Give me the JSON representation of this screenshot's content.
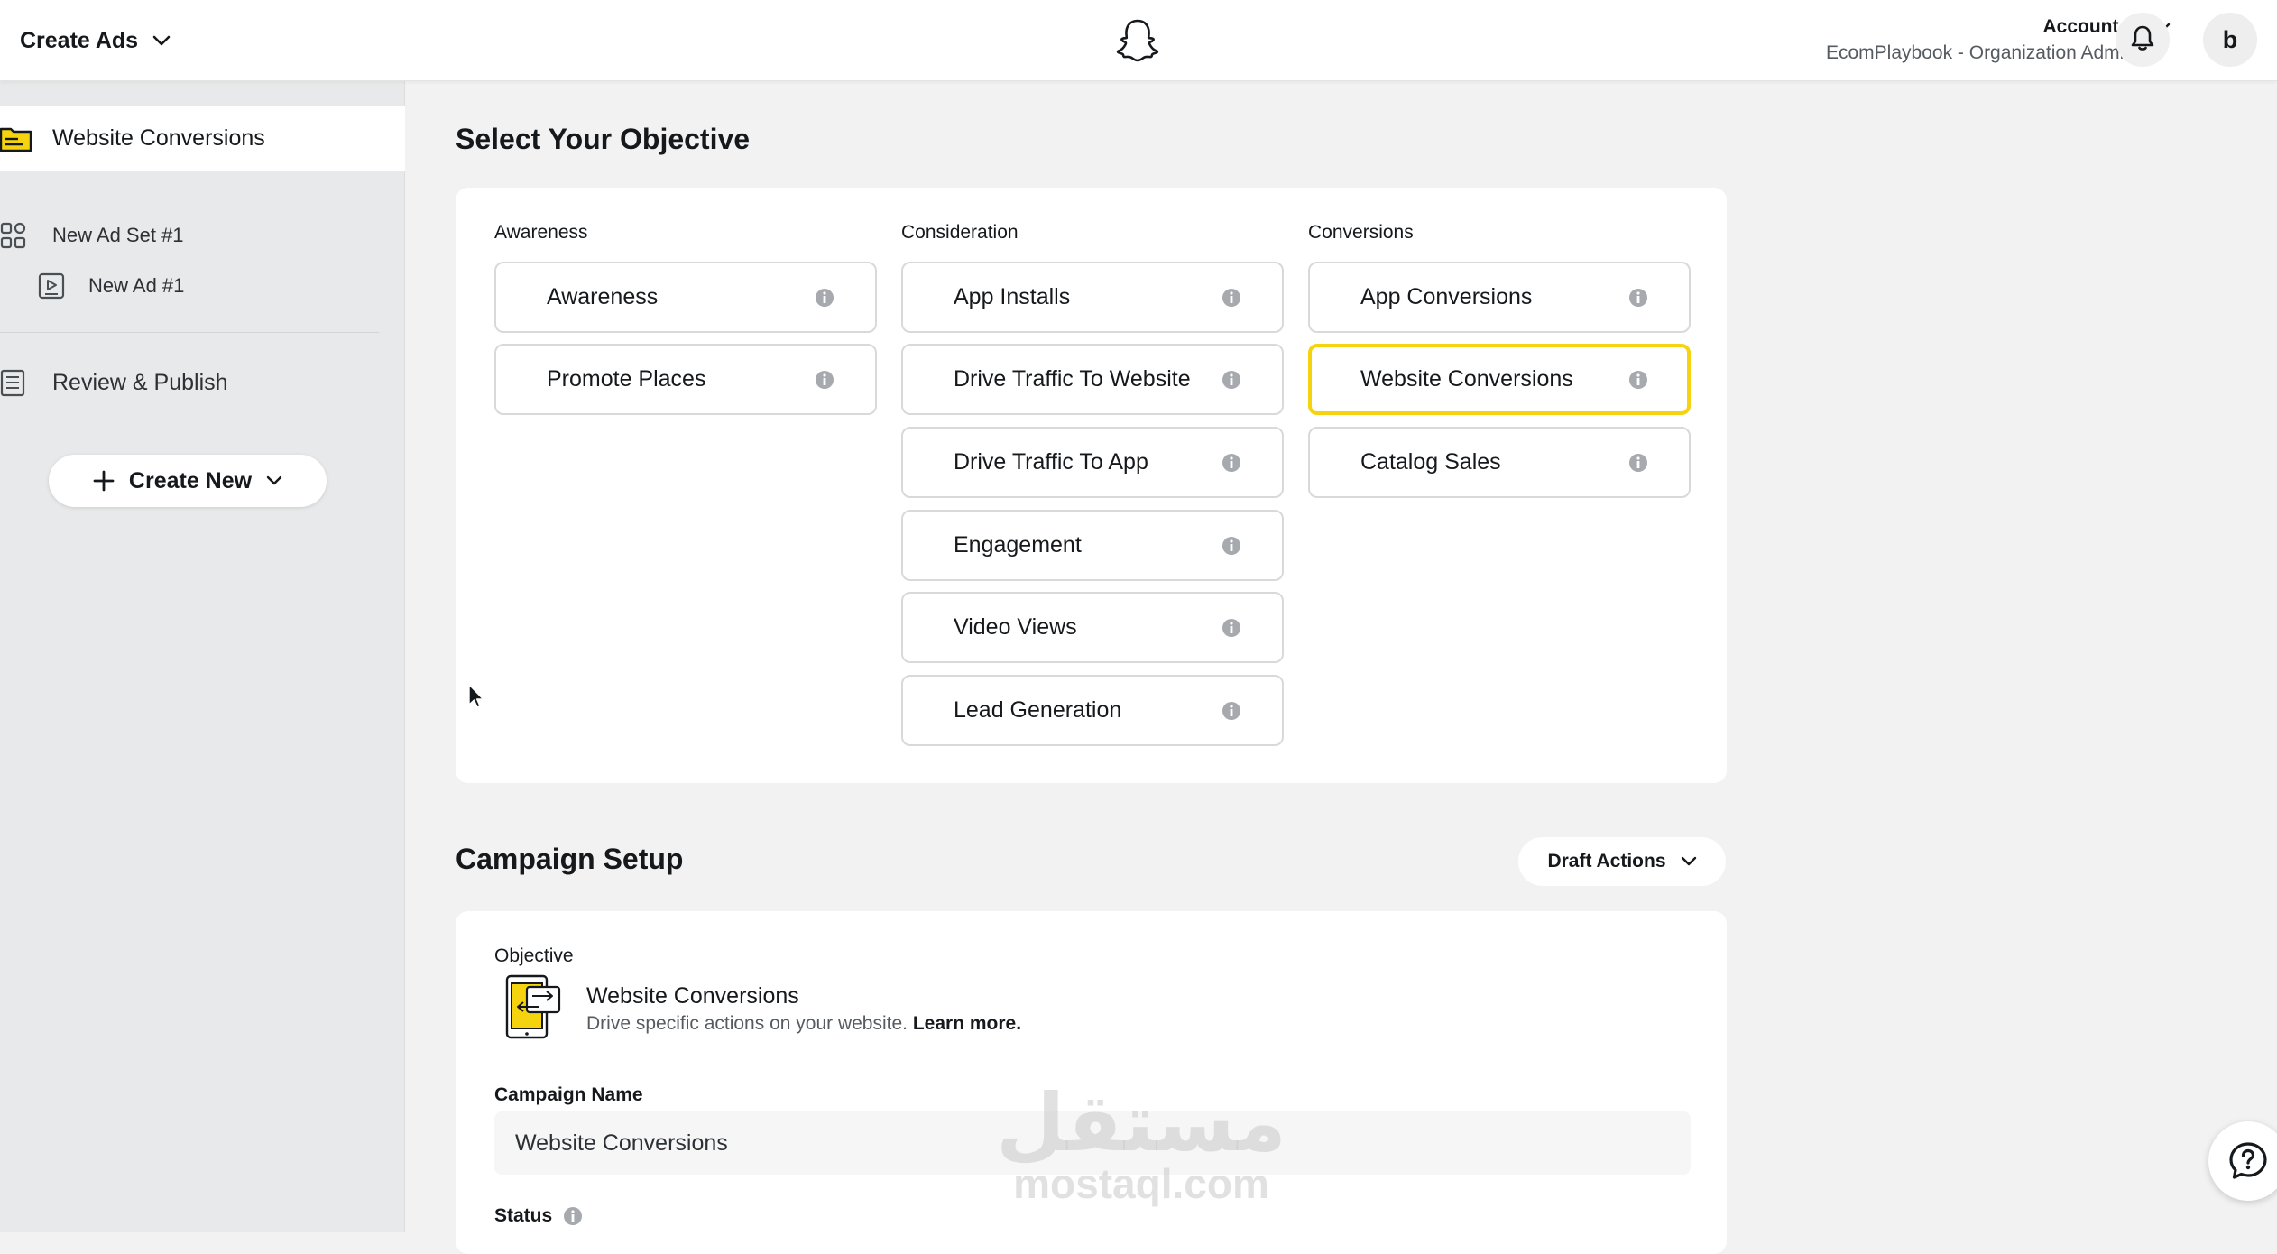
{
  "topbar": {
    "menu_label": "Create Ads",
    "account_name": "Account 1",
    "account_org": "EcomPlaybook - Organization Admin",
    "avatar_initial": "b"
  },
  "sidebar": {
    "campaign_label": "Website Conversions",
    "ad_set_label": "New Ad Set #1",
    "ad_label": "New Ad #1",
    "review_label": "Review & Publish",
    "create_new_label": "Create New"
  },
  "objective_section": {
    "title": "Select Your Objective",
    "columns": [
      {
        "heading": "Awareness",
        "items": [
          "Awareness",
          "Promote Places"
        ]
      },
      {
        "heading": "Consideration",
        "items": [
          "App Installs",
          "Drive Traffic To Website",
          "Drive Traffic To App",
          "Engagement",
          "Video Views",
          "Lead Generation"
        ]
      },
      {
        "heading": "Conversions",
        "items": [
          "App Conversions",
          "Website Conversions",
          "Catalog Sales"
        ]
      }
    ],
    "selected": "Website Conversions"
  },
  "campaign_setup": {
    "title": "Campaign Setup",
    "draft_actions_label": "Draft Actions",
    "objective_label": "Objective",
    "objective_name": "Website Conversions",
    "objective_desc": "Drive specific actions on your website.",
    "learn_more": "Learn more.",
    "campaign_name_label": "Campaign Name",
    "campaign_name_value": "Website Conversions",
    "status_label": "Status"
  },
  "watermark": {
    "arabic": "مستقل",
    "latin": "mostaql.com"
  },
  "colors": {
    "accent_yellow": "#f5d40f",
    "sidebar_bg": "#e8e9ea",
    "page_bg": "#f2f2f2"
  }
}
